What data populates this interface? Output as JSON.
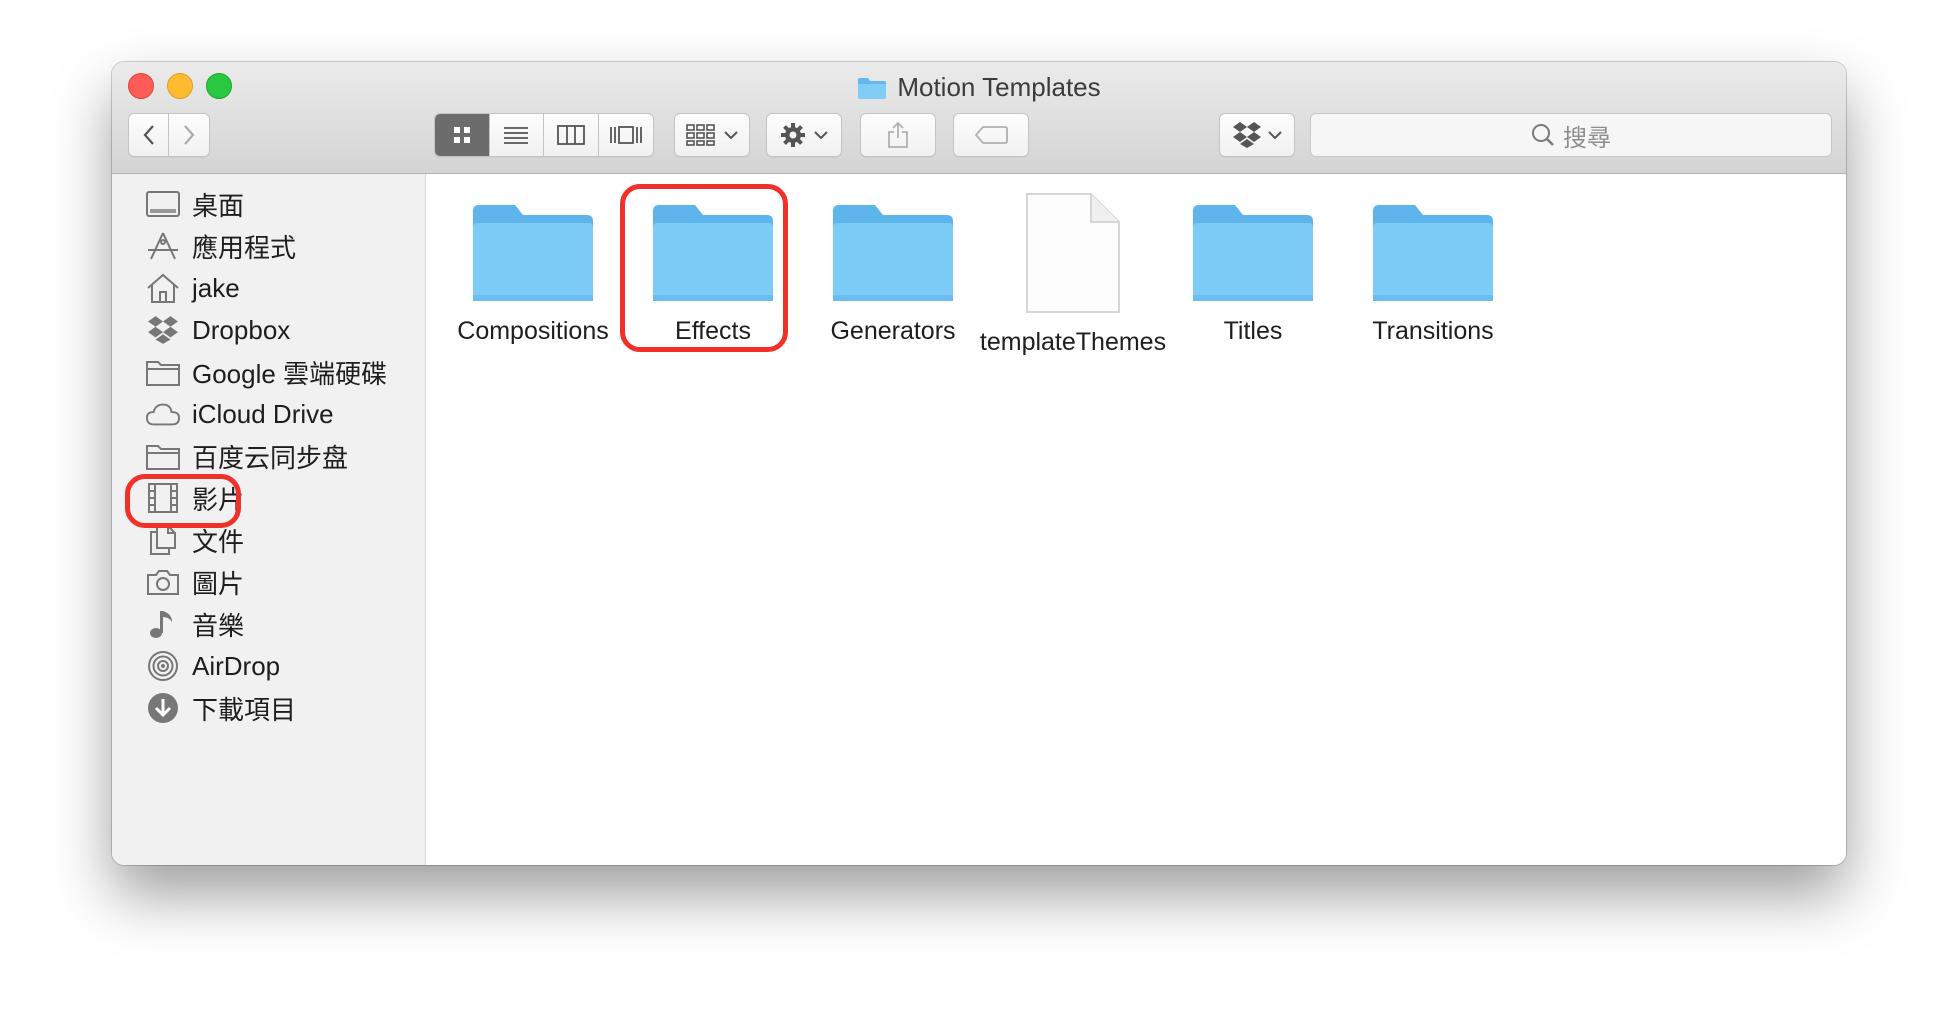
{
  "window": {
    "title": "Motion Templates",
    "title_icon": "folder-icon"
  },
  "toolbar": {
    "back_icon": "chevron-left-icon",
    "forward_icon": "chevron-right-icon",
    "view_modes": [
      "icon-view",
      "list-view",
      "column-view",
      "cover-flow-view"
    ],
    "active_view": "icon-view",
    "arrange_icon": "arrange-grid-icon",
    "action_icon": "gear-icon",
    "share_icon": "share-icon",
    "tag_icon": "tag-icon",
    "dropbox_icon": "dropbox-icon",
    "search_placeholder": "搜尋"
  },
  "sidebar": {
    "items": [
      {
        "label": "桌面",
        "icon": "desktop-icon"
      },
      {
        "label": "應用程式",
        "icon": "applications-icon"
      },
      {
        "label": "jake",
        "icon": "home-icon"
      },
      {
        "label": "Dropbox",
        "icon": "dropbox-icon"
      },
      {
        "label": "Google 雲端硬碟",
        "icon": "folder-icon"
      },
      {
        "label": "iCloud Drive",
        "icon": "cloud-icon"
      },
      {
        "label": "百度云同步盘",
        "icon": "folder-icon"
      },
      {
        "label": "影片",
        "icon": "film-icon"
      },
      {
        "label": "文件",
        "icon": "documents-icon"
      },
      {
        "label": "圖片",
        "icon": "camera-icon"
      },
      {
        "label": "音樂",
        "icon": "music-note-icon"
      },
      {
        "label": "AirDrop",
        "icon": "airdrop-icon"
      },
      {
        "label": "下載項目",
        "icon": "download-icon"
      }
    ]
  },
  "files": [
    {
      "name": "Compositions",
      "kind": "folder"
    },
    {
      "name": "Effects",
      "kind": "folder"
    },
    {
      "name": "Generators",
      "kind": "folder"
    },
    {
      "name": "templateThemes",
      "kind": "document"
    },
    {
      "name": "Titles",
      "kind": "folder"
    },
    {
      "name": "Transitions",
      "kind": "folder"
    }
  ],
  "colors": {
    "highlight": "#f0312a",
    "folder": "#72c4f5",
    "close": "#fd5d56",
    "minimize": "#fdbc2f",
    "zoom": "#28c840"
  }
}
